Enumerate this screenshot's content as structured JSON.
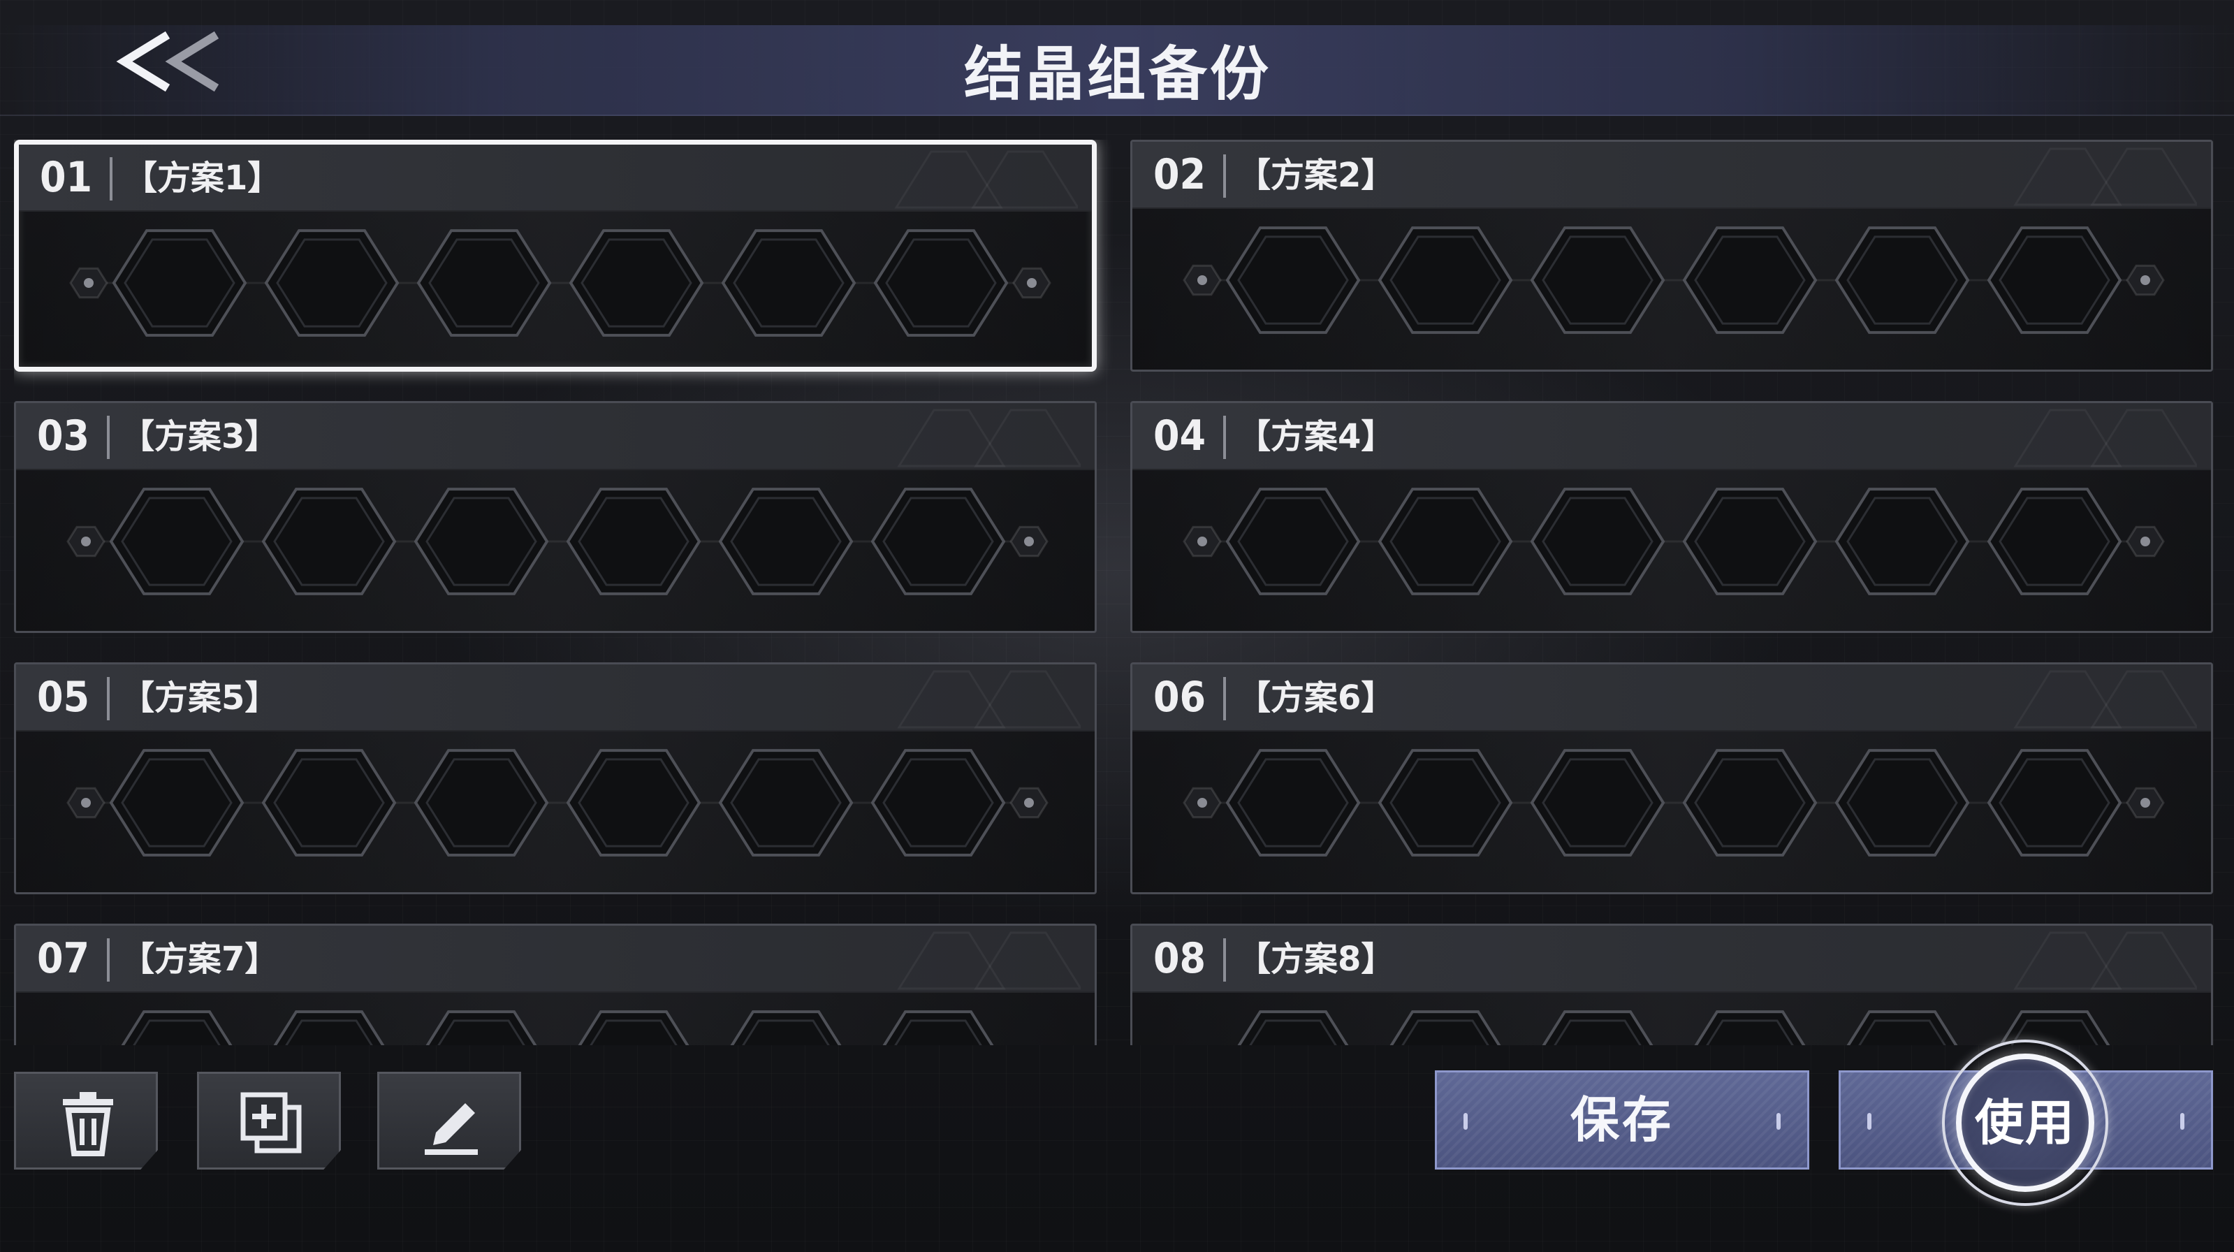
{
  "header": {
    "title": "结晶组备份",
    "back_icon": "double-chevron-left-icon"
  },
  "slots": [
    {
      "number": "01",
      "name": "【方案1】",
      "selected": true
    },
    {
      "number": "02",
      "name": "【方案2】",
      "selected": false
    },
    {
      "number": "03",
      "name": "【方案3】",
      "selected": false
    },
    {
      "number": "04",
      "name": "【方案4】",
      "selected": false
    },
    {
      "number": "05",
      "name": "【方案5】",
      "selected": false
    },
    {
      "number": "06",
      "name": "【方案6】",
      "selected": false
    },
    {
      "number": "07",
      "name": "【方案7】",
      "selected": false
    },
    {
      "number": "08",
      "name": "【方案8】",
      "selected": false
    }
  ],
  "slot_crystal_count": 6,
  "toolbar": {
    "delete_icon": "trash-icon",
    "copy_icon": "copy-add-icon",
    "edit_icon": "pencil-edit-icon",
    "save_label": "保存",
    "use_label": "使用"
  },
  "colors": {
    "accent_button": "#5a6390",
    "accent_border": "#8e98cc",
    "selected_border": "#f4f4f6",
    "panel": "#1b1c20"
  }
}
